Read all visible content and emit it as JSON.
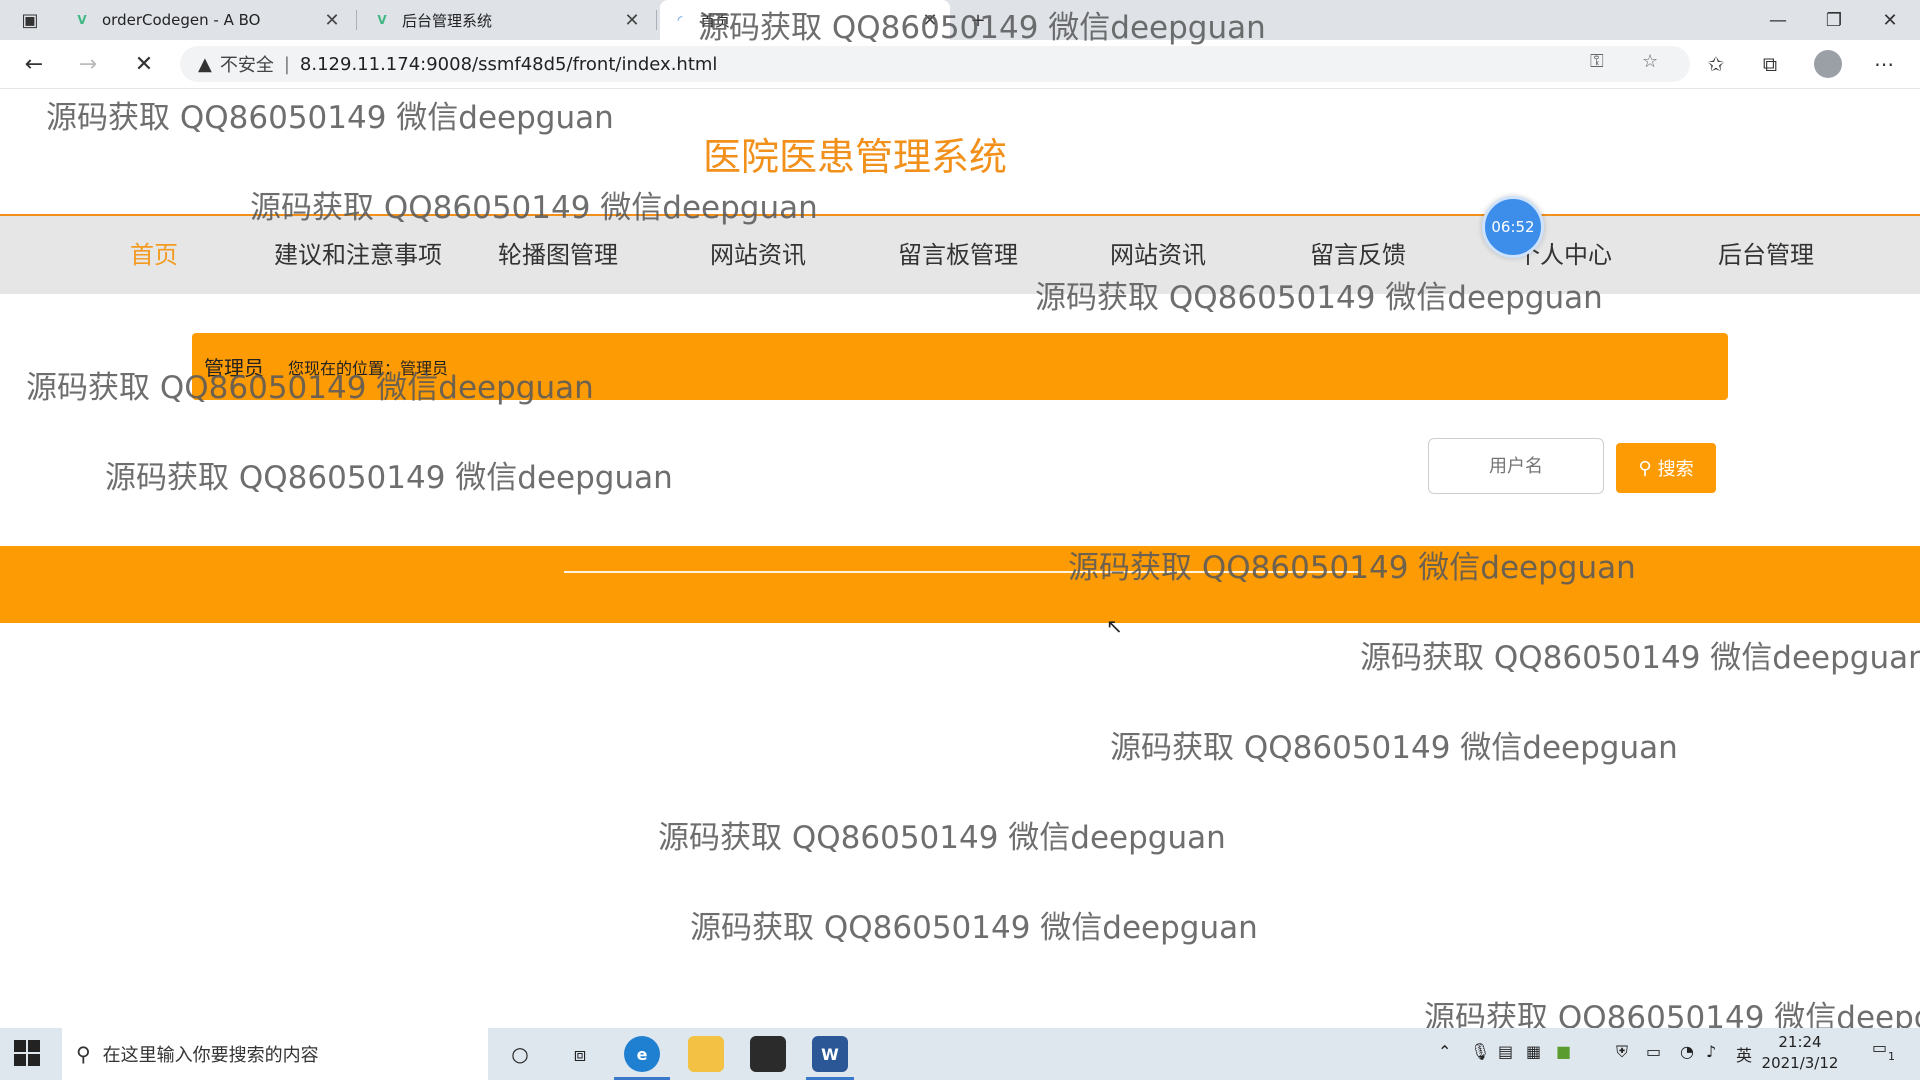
{
  "browser": {
    "tabs": [
      {
        "title": "orderCodegen - A BO",
        "icon": "vue-favicon"
      },
      {
        "title": "后台管理系统",
        "icon": "vue-favicon"
      },
      {
        "title": "首页",
        "icon": "loading-spinner-icon"
      }
    ],
    "new_tab": "+",
    "address": {
      "warning": "不安全",
      "separator": "|",
      "url": "8.129.11.174:9008/ssmf48d5/front/index.html"
    }
  },
  "site": {
    "title": "医院医患管理系统",
    "nav": [
      "首页",
      "建议和注意事项",
      "轮播图管理",
      "网站资讯",
      "留言板管理",
      "网站资讯",
      "留言反馈",
      "个人中心",
      "后台管理"
    ],
    "timer": "06:52",
    "breadcrumb": {
      "current": "管理员",
      "location": "您现在的位置：管理员"
    },
    "search": {
      "placeholder": "用户名",
      "button": "搜索"
    }
  },
  "watermark": "源码获取 QQ86050149 微信deepguan",
  "taskbar": {
    "search_placeholder": "在这里输入你要搜索的内容",
    "ime": "英",
    "time": "21:24",
    "date": "2021/3/12",
    "notifications": "1"
  },
  "colors": {
    "brand": "#f1901a",
    "accent_band": "#fd9b05",
    "nav_bg": "#e6e6e6",
    "timer": "#3d8eea"
  }
}
